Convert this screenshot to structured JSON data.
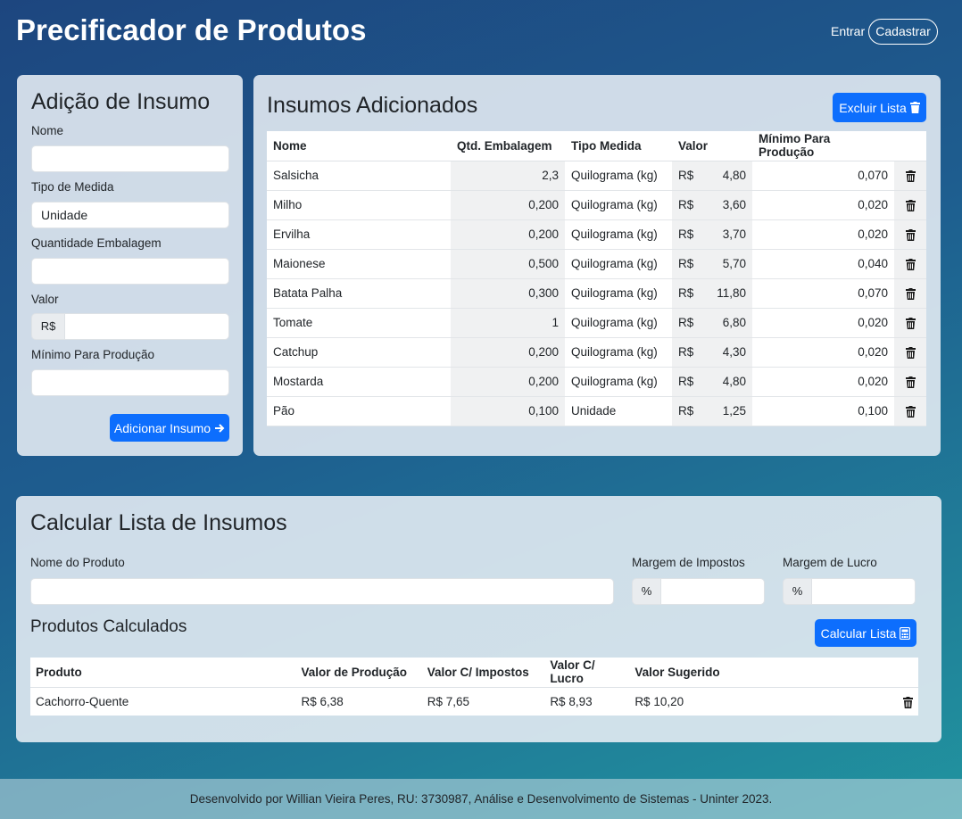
{
  "header": {
    "title": "Precificador de Produtos",
    "login": "Entrar",
    "register": "Cadastrar"
  },
  "add_form": {
    "title": "Adição de Insumo",
    "name_label": "Nome",
    "name_value": "",
    "measure_label": "Tipo de Medida",
    "measure_value": "Unidade",
    "qty_label": "Quantidade Embalagem",
    "qty_value": "",
    "value_label": "Valor",
    "currency_prefix": "R$",
    "value_value": "",
    "min_label": "Mínimo Para Produção",
    "min_value": "",
    "submit_label": "Adicionar Insumo"
  },
  "ingredients": {
    "title": "Insumos Adicionados",
    "delete_list_label": "Excluir Lista",
    "headers": [
      "Nome",
      "Qtd. Embalagem",
      "Tipo Medida",
      "Valor",
      "Mínimo Para Produção"
    ],
    "currency": "R$",
    "rows": [
      {
        "name": "Salsicha",
        "qty": "2,3",
        "unit": "Quilograma (kg)",
        "value": "4,80",
        "min": "0,070"
      },
      {
        "name": "Milho",
        "qty": "0,200",
        "unit": "Quilograma (kg)",
        "value": "3,60",
        "min": "0,020"
      },
      {
        "name": "Ervilha",
        "qty": "0,200",
        "unit": "Quilograma (kg)",
        "value": "3,70",
        "min": "0,020"
      },
      {
        "name": "Maionese",
        "qty": "0,500",
        "unit": "Quilograma (kg)",
        "value": "5,70",
        "min": "0,040"
      },
      {
        "name": "Batata Palha",
        "qty": "0,300",
        "unit": "Quilograma (kg)",
        "value": "11,80",
        "min": "0,070"
      },
      {
        "name": "Tomate",
        "qty": "1",
        "unit": "Quilograma (kg)",
        "value": "6,80",
        "min": "0,020"
      },
      {
        "name": "Catchup",
        "qty": "0,200",
        "unit": "Quilograma (kg)",
        "value": "4,30",
        "min": "0,020"
      },
      {
        "name": "Mostarda",
        "qty": "0,200",
        "unit": "Quilograma (kg)",
        "value": "4,80",
        "min": "0,020"
      },
      {
        "name": "Pão",
        "qty": "0,100",
        "unit": "Unidade",
        "value": "1,25",
        "min": "0,100"
      }
    ]
  },
  "calc": {
    "title": "Calcular Lista de Insumos",
    "product_label": "Nome do Produto",
    "product_value": "",
    "tax_label": "Margem de Impostos",
    "profit_label": "Margem de Lucro",
    "percent_prefix": "%",
    "subtitle": "Produtos Calculados",
    "calc_button": "Calcular Lista",
    "headers": [
      "Produto",
      "Valor de Produção",
      "Valor C/ Impostos",
      "Valor C/ Lucro",
      "Valor Sugerido"
    ],
    "rows": [
      {
        "product": "Cachorro-Quente",
        "production": "R$ 6,38",
        "with_tax": "R$ 7,65",
        "with_profit": "R$ 8,93",
        "suggested": "R$ 10,20"
      }
    ]
  },
  "footer": {
    "text": "Desenvolvido por Willian Vieira Peres, RU: 3730987, Análise e Desenvolvimento de Sistemas - Uninter 2023."
  },
  "colors": {
    "primary": "#0d6efd",
    "background_start": "#1d467f",
    "background_end": "#21949f"
  }
}
